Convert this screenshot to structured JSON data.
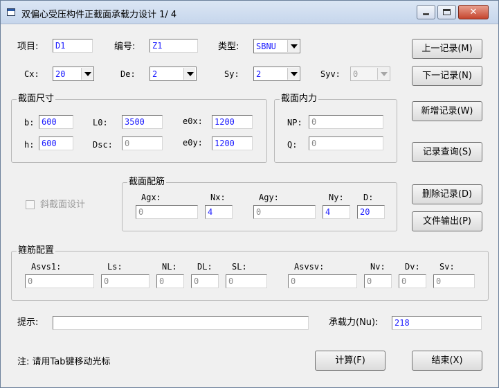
{
  "window": {
    "title": "双偏心受压构件正截面承载力设计 1/ 4",
    "close_glyph": "✕"
  },
  "top": {
    "project_label": "项目:",
    "project_value": "D1",
    "code_label": "编号:",
    "code_value": "Z1",
    "type_label": "类型:",
    "type_value": "SBNU",
    "cx_label": "Cx:",
    "cx_value": "20",
    "de_label": "De:",
    "de_value": "2",
    "sy_label": "Sy:",
    "sy_value": "2",
    "syv_label": "Syv:",
    "syv_value": "0"
  },
  "section_size": {
    "title": "截面尺寸",
    "b_label": "b:",
    "b_value": "600",
    "h_label": "h:",
    "h_value": "600",
    "l0_label": "L0:",
    "l0_value": "3500",
    "dsc_label": "Dsc:",
    "dsc_value": "0",
    "e0x_label": "e0x:",
    "e0x_value": "1200",
    "e0y_label": "e0y:",
    "e0y_value": "1200"
  },
  "section_force": {
    "title": "截面内力",
    "np_label": "NP:",
    "np_value": "0",
    "q_label": "Q:",
    "q_value": "0"
  },
  "oblique": {
    "label": "斜截面设计"
  },
  "rebar": {
    "title": "截面配筋",
    "agx_label": "Agx:",
    "agx_value": "0",
    "nx_label": "Nx:",
    "nx_value": "4",
    "agy_label": "Agy:",
    "agy_value": "0",
    "ny_label": "Ny:",
    "ny_value": "4",
    "d_label": "D:",
    "d_value": "20"
  },
  "stirrup": {
    "title": "箍筋配置",
    "asvs1_label": "Asvs1:",
    "asvs1_value": "0",
    "ls_label": "Ls:",
    "ls_value": "0",
    "nl_label": "NL:",
    "nl_value": "0",
    "dl_label": "DL:",
    "dl_value": "0",
    "sl_label": "SL:",
    "sl_value": "0",
    "asvsv_label": "Asvsv:",
    "asvsv_value": "0",
    "nv_label": "Nv:",
    "nv_value": "0",
    "dv_label": "Dv:",
    "dv_value": "0",
    "sv_label": "Sv:",
    "sv_value": "0"
  },
  "bottom": {
    "hint_label": "提示:",
    "hint_value": "",
    "capacity_label": "承载力(Nu):",
    "capacity_value": "218",
    "note": "注: 请用Tab键移动光标"
  },
  "buttons": {
    "prev": "上一记录(M)",
    "next": "下一记录(N)",
    "add": "新增记录(W)",
    "query": "记录查询(S)",
    "delete": "删除记录(D)",
    "export": "文件输出(P)",
    "calc": "计算(F)",
    "end": "结束(X)"
  }
}
